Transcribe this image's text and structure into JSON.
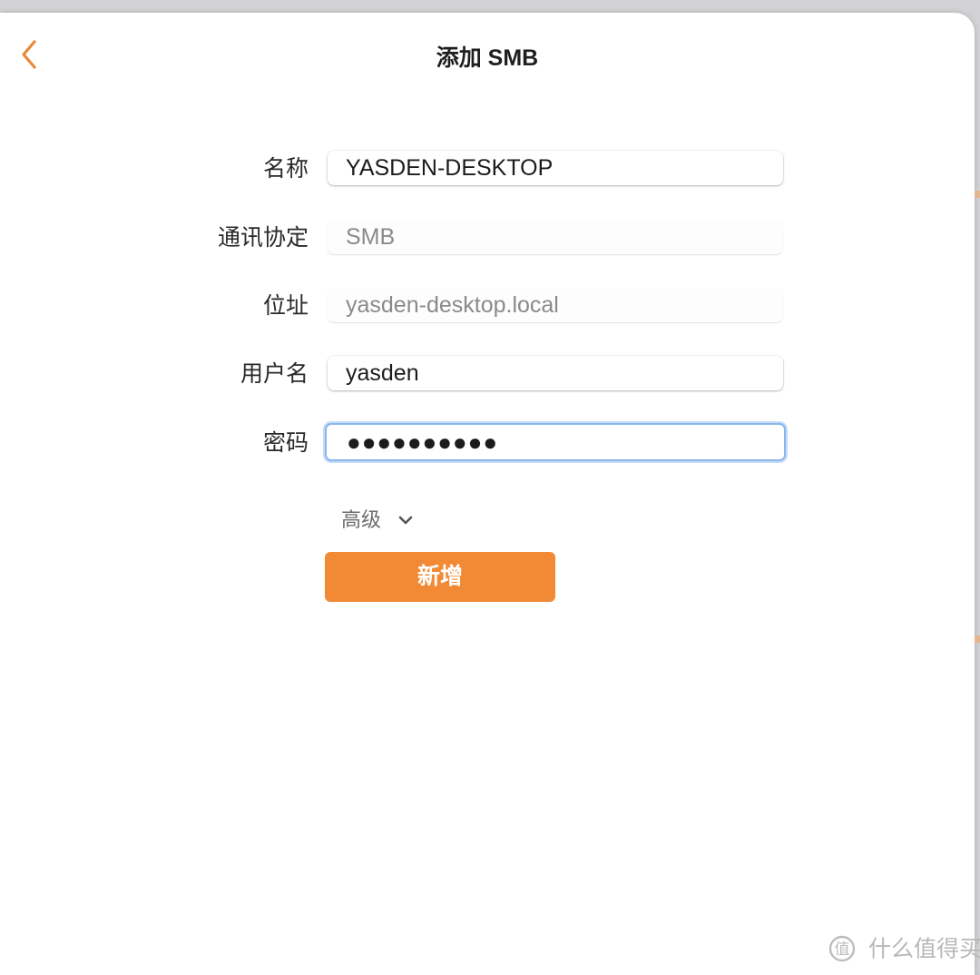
{
  "header": {
    "title": "添加 SMB",
    "back_icon": "chevron-left-icon"
  },
  "form": {
    "fields": [
      {
        "label": "名称",
        "value": "YASDEN-DESKTOP",
        "editable": true
      },
      {
        "label": "通讯协定",
        "value": "SMB",
        "editable": false
      },
      {
        "label": "位址",
        "value": "yasden-desktop.local",
        "editable": false
      },
      {
        "label": "用户名",
        "value": "yasden",
        "editable": true
      },
      {
        "label": "密码",
        "value": "●●●●●●●●●●",
        "editable": true,
        "focused": true
      }
    ],
    "advanced_label": "高级",
    "advanced_icon": "chevron-down-icon",
    "submit_label": "新增"
  },
  "watermark": {
    "text": "什么值得买",
    "icon": "zhide-logo-icon"
  },
  "colors": {
    "accent": "#f28a35",
    "back_icon": "#e8893a",
    "focus_ring": "#8ab6ec",
    "background": "#ffffff",
    "backdrop": "#d2d2d4"
  }
}
